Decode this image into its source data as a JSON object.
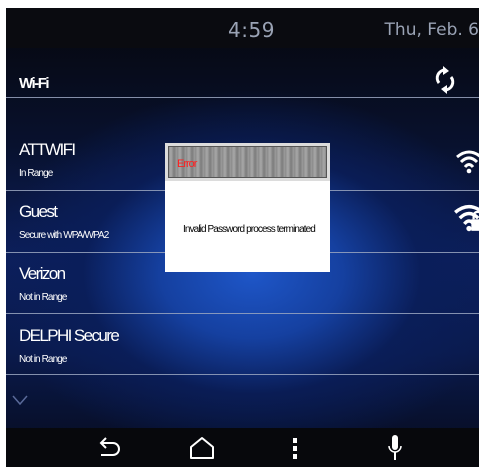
{
  "status_bar": {
    "time": "4:59",
    "date": "Thu, Feb. 6"
  },
  "header": {
    "title": "Wi-Fi"
  },
  "networks": [
    {
      "name": "ATTWIFI",
      "status": "In Range",
      "signal_icon": "wifi-signal-icon",
      "locked": false
    },
    {
      "name": "Guest",
      "status": "Secure with WPA/WPA2",
      "signal_icon": "wifi-signal-locked-icon",
      "locked": true
    },
    {
      "name": "Verizon",
      "status": "Not in Range"
    },
    {
      "name": "DELPHI Secure",
      "status": "Not in Range"
    }
  ],
  "dialog": {
    "title": "Error",
    "message": "Invalid Password process terminated"
  },
  "nav_bar": {
    "buttons": [
      "back-icon",
      "home-icon",
      "menu-icon",
      "microphone-icon"
    ]
  },
  "colors": {
    "error_title": "#ff1e1e",
    "accent_blue": "#1540a0",
    "status_text": "#9aa3b5"
  }
}
